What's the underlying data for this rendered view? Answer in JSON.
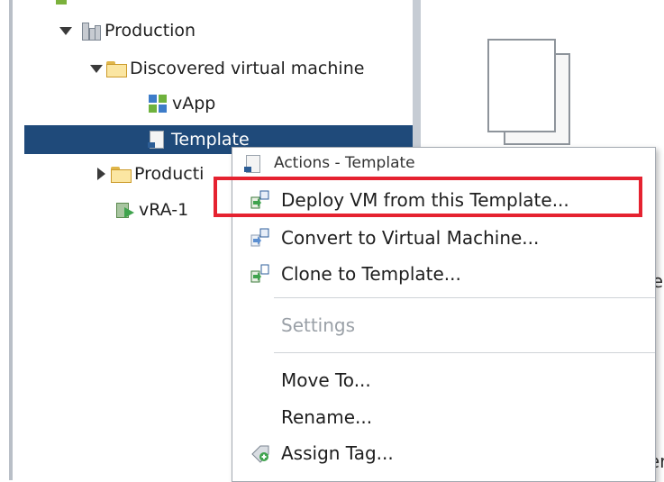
{
  "tree": {
    "items": [
      {
        "label": "Production"
      },
      {
        "label": "Discovered virtual machine"
      },
      {
        "label": "vApp"
      },
      {
        "label": "Template"
      },
      {
        "label": "Producti"
      },
      {
        "label": "vRA-1"
      }
    ]
  },
  "context_menu": {
    "header": "Actions - Template",
    "items": [
      {
        "label": "Deploy VM from this Template...",
        "highlighted": true
      },
      {
        "label": "Convert to Virtual Machine..."
      },
      {
        "label": "Clone to Template..."
      },
      {
        "label": "Settings",
        "disabled": true
      },
      {
        "label": "Move To..."
      },
      {
        "label": "Rename..."
      },
      {
        "label": "Assign Tag..."
      }
    ]
  },
  "right_panel": {
    "partial_text_1": "re",
    "partial_text_2": "ter"
  },
  "colors": {
    "selection": "#1f4a7a",
    "highlight_border": "#e52230",
    "disabled_text": "#9aa0a7"
  }
}
